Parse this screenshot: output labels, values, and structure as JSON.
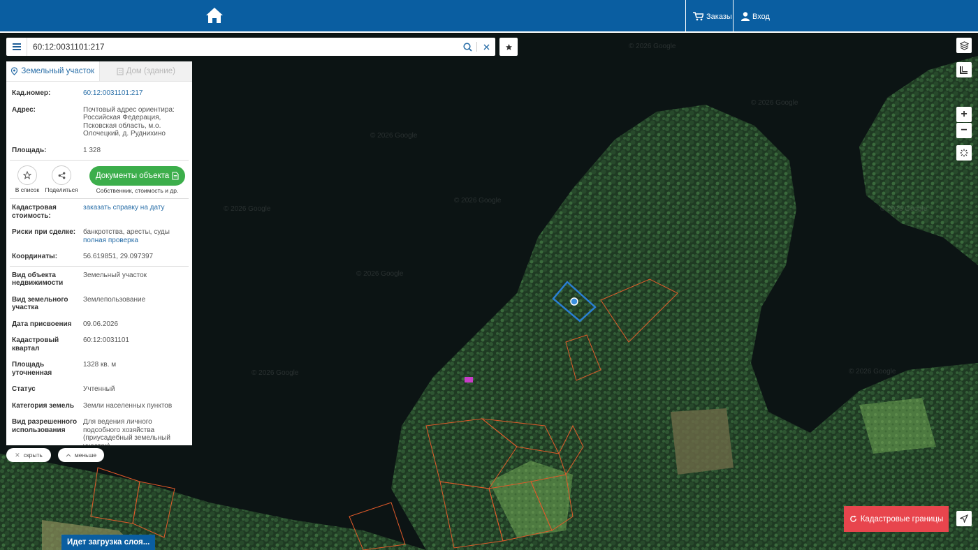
{
  "header": {
    "orders_label": "Заказы",
    "login_label": "Вход",
    "colors": {
      "bar": "#0a5ea1",
      "accent_red": "#e8454d",
      "accent_green": "#3cae4b"
    }
  },
  "search": {
    "value": "60:12:0031101:217"
  },
  "map": {
    "watermark": "© 2026 Google"
  },
  "panel": {
    "tabs": [
      {
        "label": "Земельный участок",
        "icon": "parcel-icon",
        "active": true
      },
      {
        "label": "Дом (здание)",
        "icon": "building-icon",
        "active": false
      }
    ],
    "cad_number": {
      "label": "Кад.номер:",
      "value": "60:12:0031101:217"
    },
    "address": {
      "label": "Адрес:",
      "value": "Почтовый адрес ориентира: Российская Федерация, Псковская область, м.о. Олочецкий, д. Руднихино"
    },
    "area": {
      "label": "Площадь:",
      "value": "1 328"
    },
    "actions": {
      "to_list": "В список",
      "share": "Поделиться",
      "docs_button": "Документы объекта",
      "docs_sub": "Собственник, стоимость и др."
    },
    "cad_cost": {
      "label": "Кадастровая стоимость:",
      "value": "заказать справку на дату"
    },
    "risks": {
      "label": "Риски при сделке:",
      "value": "банкротства, аресты, суды",
      "link": "полная проверка"
    },
    "coords": {
      "label": "Координаты:",
      "value": "56.619851, 29.097397"
    },
    "details": [
      {
        "label": "Вид объекта недвижимости",
        "value": "Земельный участок"
      },
      {
        "label": "Вид земельного участка",
        "value": "Землепользование"
      },
      {
        "label": "Дата присвоения",
        "value": "09.06.2026"
      },
      {
        "label": "Кадастровый квартал",
        "value": "60:12:0031101"
      },
      {
        "label": "Площадь уточненная",
        "value": "1328 кв. м"
      },
      {
        "label": "Статус",
        "value": "Учтенный"
      },
      {
        "label": "Категория земель",
        "value": "Земли населенных пунктов"
      },
      {
        "label": "Вид разрешенного использования",
        "value": "Для ведения личного подсобного хозяйства (приусадебный земельный участок)"
      }
    ]
  },
  "pills": {
    "hide": "скрыть",
    "less": "меньше"
  },
  "controls": {
    "cadastral_borders": "Кадастровые границы",
    "loading": "Идет загрузка слоя..."
  }
}
